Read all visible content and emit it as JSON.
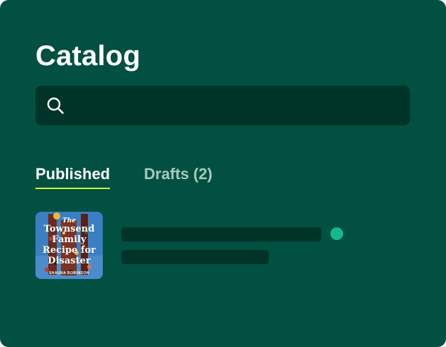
{
  "header": {
    "title": "Catalog"
  },
  "search": {
    "placeholder": "",
    "value": "",
    "icon": "search-icon"
  },
  "tabs": [
    {
      "label": "Published",
      "active": true
    },
    {
      "label": "Drafts (2)",
      "active": false
    }
  ],
  "list": {
    "items": [
      {
        "cover": {
          "lines": [
            "The",
            "Townsend",
            "Family",
            "Recipe for",
            "Disaster"
          ],
          "author": "SHAUNA ROBINSON"
        },
        "status": "published"
      }
    ]
  },
  "colors": {
    "background": "#015041",
    "search_bg": "#003428",
    "tab_active": "#ffffff",
    "tab_inactive": "#a8c9bd",
    "tab_underline": "#d4f43a",
    "status_dot": "#14b98a",
    "placeholder_bar": "#003428"
  }
}
